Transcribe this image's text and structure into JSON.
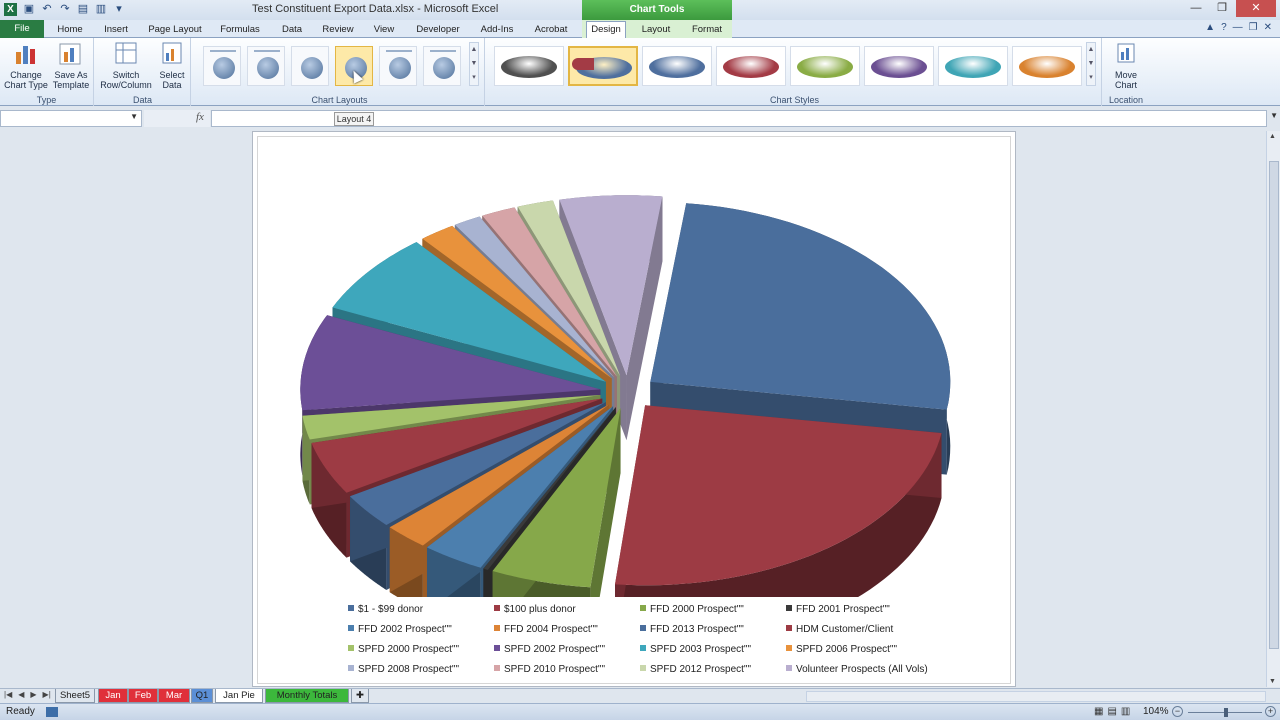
{
  "window": {
    "title": "Test Constituent Export Data.xlsx - Microsoft Excel",
    "context_tab_title": "Chart Tools"
  },
  "ribbon_tabs": [
    {
      "label": "File"
    },
    {
      "label": "Home"
    },
    {
      "label": "Insert"
    },
    {
      "label": "Page Layout"
    },
    {
      "label": "Formulas"
    },
    {
      "label": "Data"
    },
    {
      "label": "Review"
    },
    {
      "label": "View"
    },
    {
      "label": "Developer"
    },
    {
      "label": "Add-Ins"
    },
    {
      "label": "Acrobat"
    },
    {
      "label": "Design"
    },
    {
      "label": "Layout"
    },
    {
      "label": "Format"
    }
  ],
  "active_tab": "Design",
  "ribbon": {
    "type_group": {
      "label": "Type",
      "change_chart_type": "Change Chart Type",
      "save_as_template": "Save As Template"
    },
    "data_group": {
      "label": "Data",
      "switch_row_column": "Switch Row/Column",
      "select_data": "Select Data"
    },
    "layouts_group": {
      "label": "Chart Layouts",
      "selected_index": 3
    },
    "styles_group": {
      "label": "Chart Styles",
      "selected_index": 1,
      "colors": [
        "#505050",
        "#4f6f9e",
        "#4f6f9e",
        "#a33b45",
        "#8aac45",
        "#6b4f92",
        "#3fa5b5",
        "#d9822f"
      ]
    },
    "location_group": {
      "label": "Location",
      "move_chart": "Move Chart"
    }
  },
  "tooltip": "Layout 4",
  "formula_bar": {
    "name_box": "",
    "fx": "fx",
    "formula": ""
  },
  "chart_data": {
    "type": "pie",
    "categories": [
      "$1 - $99 donor",
      "$100 plus donor",
      "FFD 2000 Prospect\"\"",
      "FFD 2001 Prospect\"\"",
      "FFD 2002 Prospect\"\"",
      "FFD 2004 Prospect\"\"",
      "FFD 2013 Prospect\"\"",
      "HDM Customer/Client",
      "SPFD 2000 Prospect\"\"",
      "SPFD 2002 Prospect\"\"",
      "SPFD 2003 Prospect\"\"",
      "SPFD 2006 Prospect\"\"",
      "SPFD 2008 Prospect\"\"",
      "SPFD 2010 Prospect\"\"",
      "SPFD 2012 Prospect\"\"",
      "Volunteer Prospects (All Vols)"
    ],
    "values": [
      28.8,
      27.2,
      6.1,
      0.3,
      3.8,
      2.7,
      3.6,
      5.4,
      2.4,
      9.7,
      8.3,
      2.2,
      1.7,
      2.1,
      2.2,
      6.2
    ],
    "colors": [
      "#4a6e9c",
      "#9d3b44",
      "#86a84a",
      "#3a3a3a",
      "#4c7fae",
      "#dd8436",
      "#4a6e9c",
      "#9d3b44",
      "#a3c26a",
      "#6c4f97",
      "#3ea7bc",
      "#e8923c",
      "#a8b3d1",
      "#d6a4a7",
      "#c9d7ac",
      "#b9aecf"
    ],
    "exploded": true,
    "legend_position": "bottom"
  },
  "sheet_tabs": [
    {
      "label": "Sheet5",
      "color": "#dfe6ee"
    },
    {
      "label": "Jan",
      "color": "#e0303a"
    },
    {
      "label": "Feb",
      "color": "#e0303a"
    },
    {
      "label": "Mar",
      "color": "#e0303a"
    },
    {
      "label": "Q1",
      "color": "#5b8fd6"
    },
    {
      "label": "Jan Pie",
      "color": "#ffffff"
    },
    {
      "label": "Monthly Totals",
      "color": "#3cb83c"
    }
  ],
  "active_sheet": "Jan Pie",
  "status": {
    "ready": "Ready",
    "zoom": "104%"
  }
}
